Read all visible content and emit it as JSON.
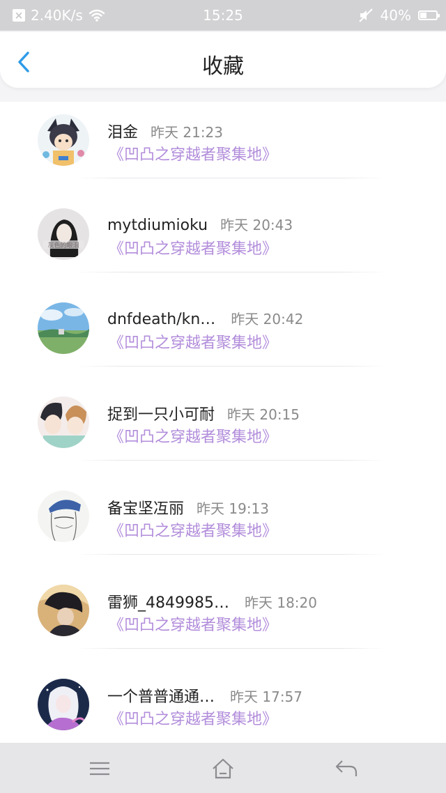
{
  "status_bar": {
    "speed": "2.40K/s",
    "time": "15:25",
    "battery": "40%",
    "battery_level": 0.4
  },
  "header": {
    "title": "收藏"
  },
  "items": [
    {
      "name": "泪金",
      "time": "昨天  21:23",
      "tag": "《凹凸之穿越者聚集地》"
    },
    {
      "name": "mytdiumioku",
      "time": "昨天  20:43",
      "tag": "《凹凸之穿越者聚集地》",
      "avatar_text": "灰色的眼泪"
    },
    {
      "name": "dnfdeath/kn…",
      "time": "昨天  20:42",
      "tag": "《凹凸之穿越者聚集地》"
    },
    {
      "name": "捉到一只小可耐",
      "time": "昨天  20:15",
      "tag": "《凹凸之穿越者聚集地》"
    },
    {
      "name": "备宝坚冱丽",
      "time": "昨天  19:13",
      "tag": "《凹凸之穿越者聚集地》"
    },
    {
      "name": "雷狮_4849985…",
      "time": "昨天  18:20",
      "tag": "《凹凸之穿越者聚集地》"
    },
    {
      "name": "一个普普通通…",
      "time": "昨天  17:57",
      "tag": "《凹凸之穿越者聚集地》"
    }
  ],
  "icons": {
    "back": "back-arrow-icon",
    "menu": "menu-icon",
    "home": "home-icon",
    "return": "return-icon"
  },
  "colors": {
    "accent": "#2f9be8",
    "tag": "#b28ddb"
  }
}
